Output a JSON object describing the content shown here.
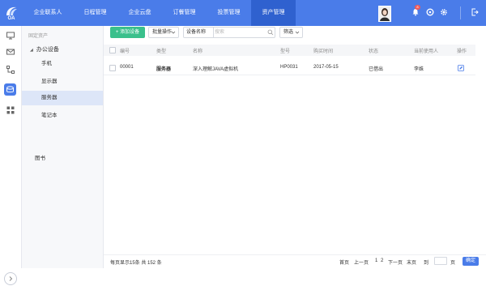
{
  "app": {
    "logo_text": "OA"
  },
  "nav": {
    "items": [
      {
        "label": "企业联系人"
      },
      {
        "label": "日程管理"
      },
      {
        "label": "企业云盘"
      },
      {
        "label": "订餐管理"
      },
      {
        "label": "投票管理"
      },
      {
        "label": "资产管理"
      }
    ],
    "active_index": 5,
    "notification_count": "8"
  },
  "sidebar": {
    "group_title": "固定资产",
    "category": "办公设备",
    "items": [
      {
        "label": "手机"
      },
      {
        "label": "显示器"
      },
      {
        "label": "服务器"
      },
      {
        "label": "笔记本"
      }
    ],
    "active_index": 2,
    "other": "图书"
  },
  "toolbar": {
    "add_label": "+ 添加设备",
    "batch_label": "批量操作",
    "search_label": "设备名称",
    "search_placeholder": "搜索",
    "filter_label": "筛选"
  },
  "table": {
    "columns": [
      "编号",
      "类型",
      "名称",
      "型号",
      "购买时间",
      "状态",
      "当前使用人",
      "操作"
    ],
    "rows": [
      {
        "id": "00001",
        "type": "服务器",
        "name": "深入理解JAVA虚拟机",
        "model": "HP0031",
        "date": "2017-05-15",
        "status": "已借出",
        "user": "李姝"
      }
    ]
  },
  "footer": {
    "info": "每页显示15条  共 152 条",
    "first": "首页",
    "prev": "上一页",
    "page1": "1",
    "page2": "2",
    "next": "下一页",
    "last": "末页",
    "goto": "到",
    "page_unit": "页",
    "confirm": "确定"
  },
  "colors": {
    "primary": "#4a7ce9",
    "active_nav": "#2f61cf",
    "add_button": "#3ac08c",
    "badge": "#f05a5a"
  }
}
